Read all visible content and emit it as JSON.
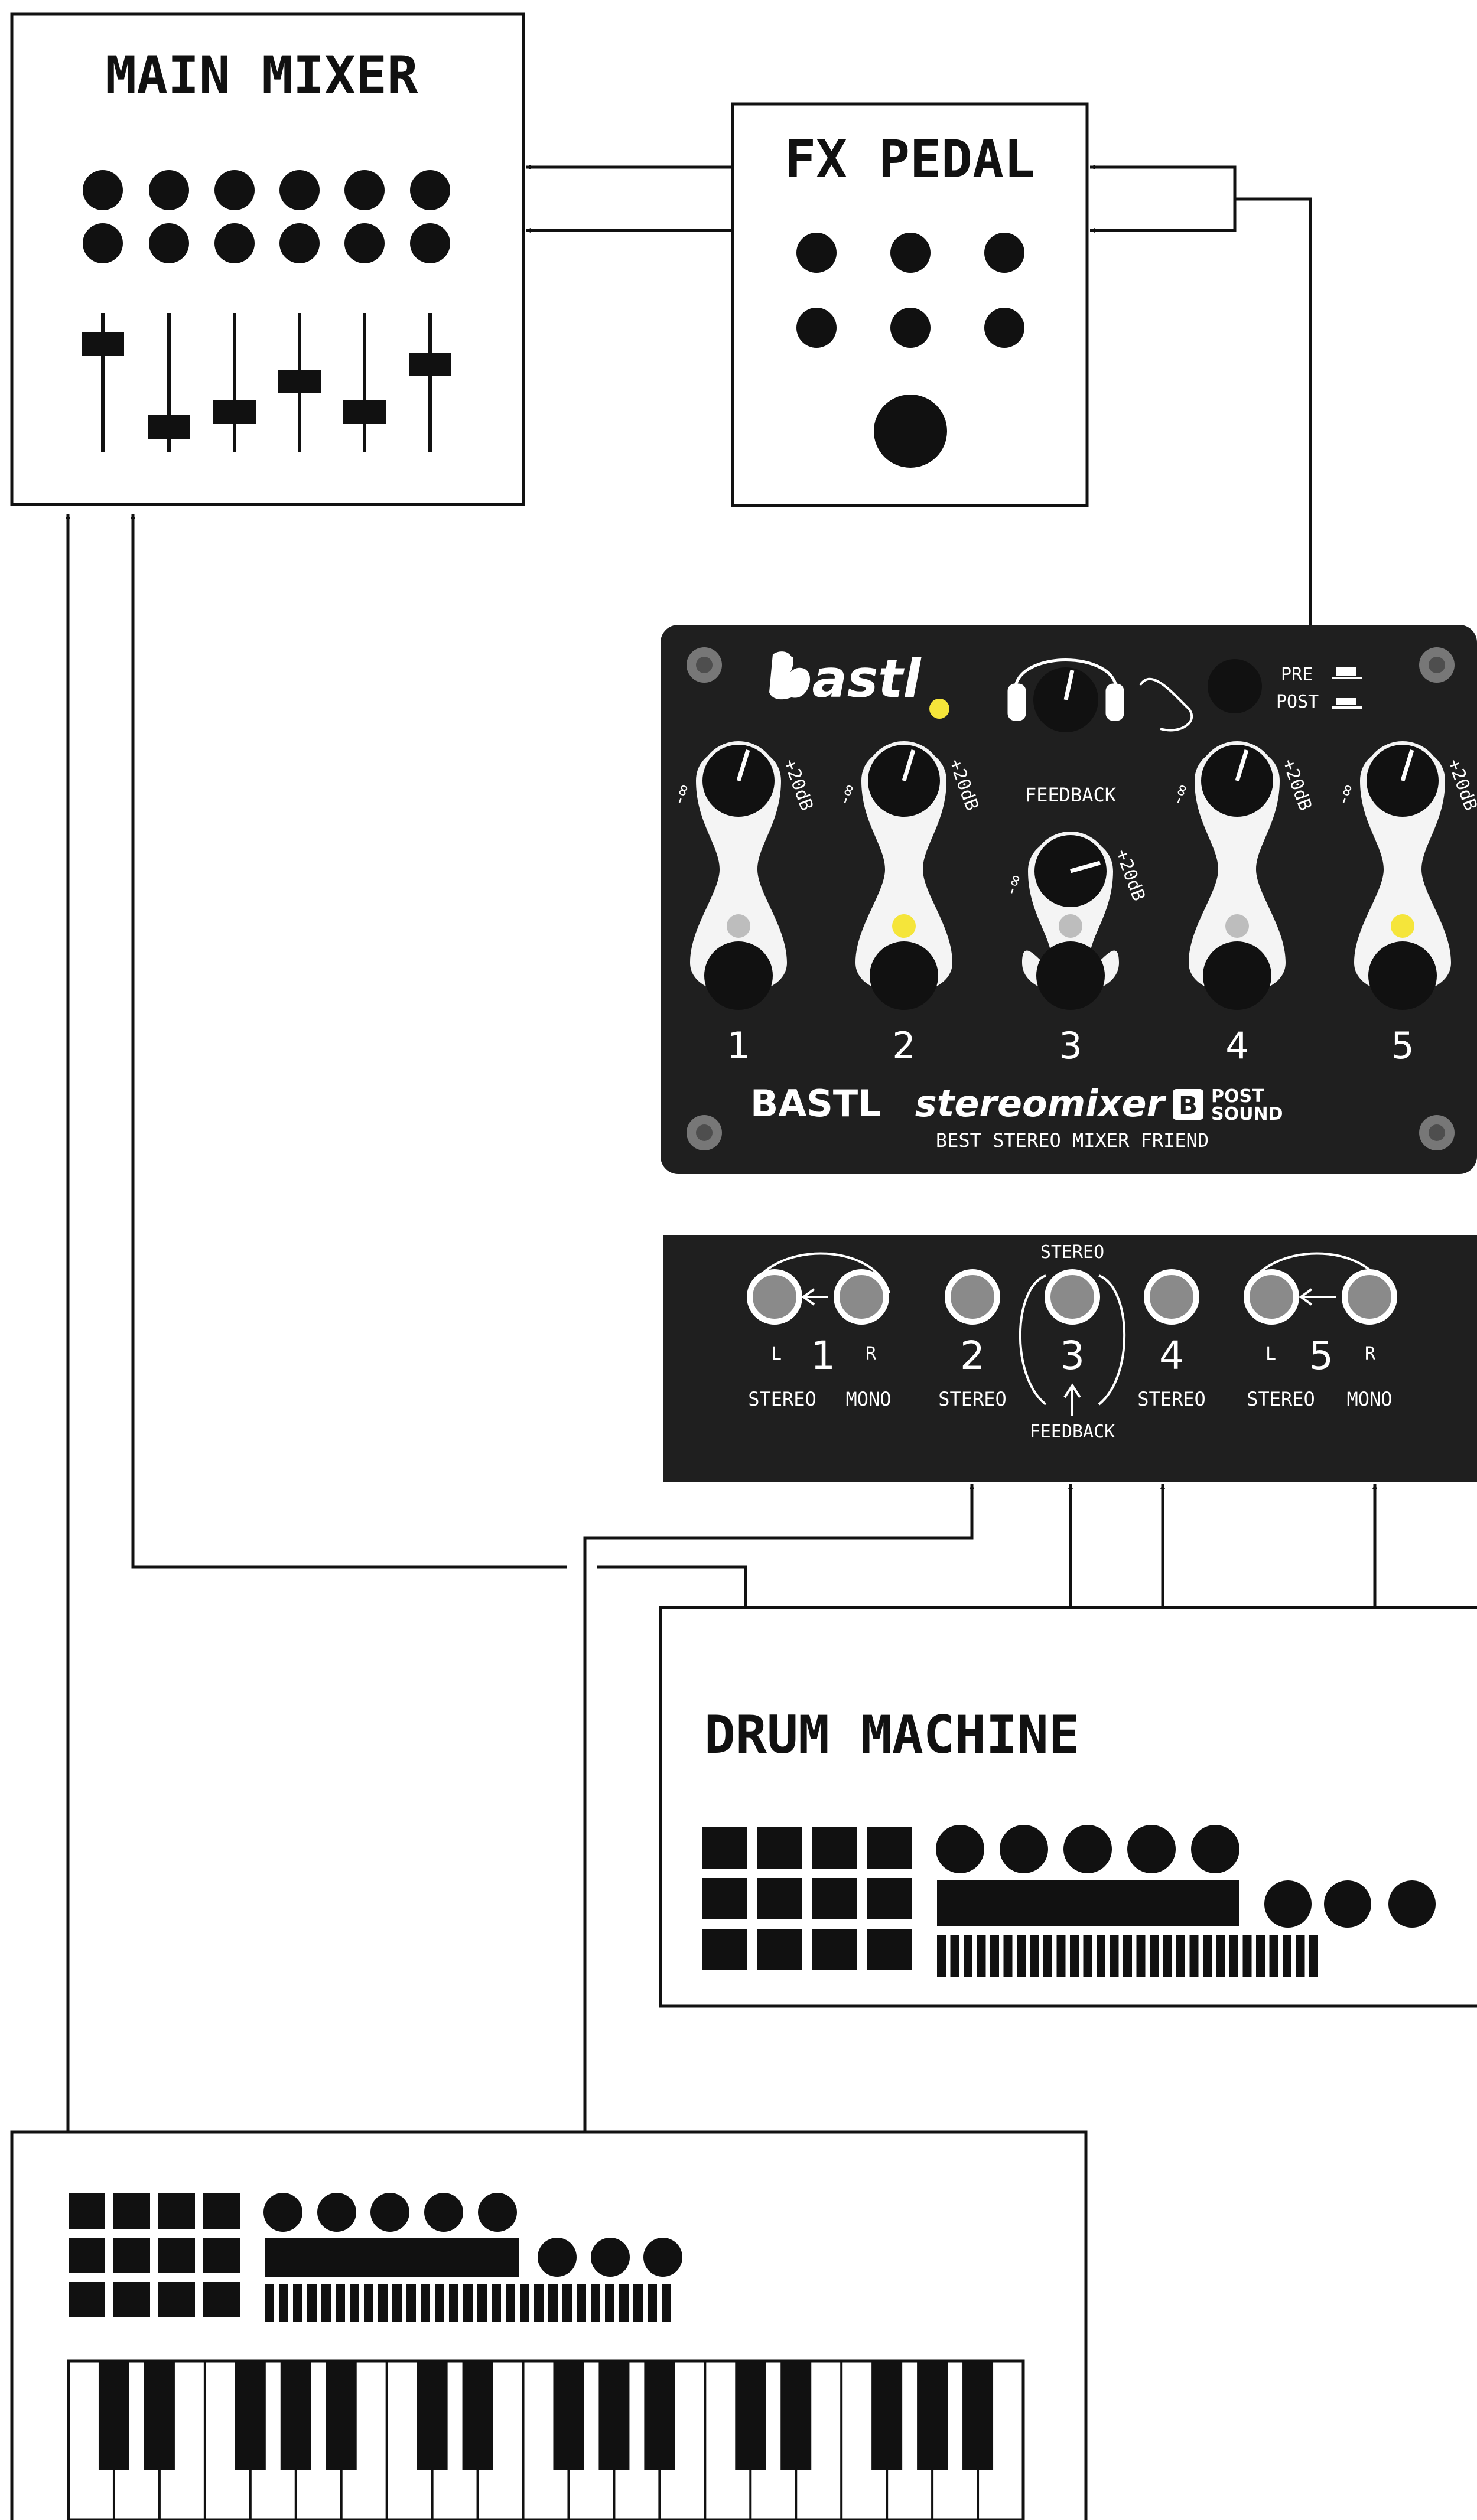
{
  "devices": {
    "main_mixer": {
      "title": "MAIN MIXER"
    },
    "fx_pedal": {
      "title": "FX PEDAL"
    },
    "drum_machine": {
      "title": "DRUM MACHINE"
    }
  },
  "stereomixer": {
    "brand": "BASTL",
    "product_script": "stereomixer",
    "partner_badge": "B",
    "partner": [
      "POST",
      "SOUND"
    ],
    "logo_script": "bastl",
    "tagline": "BEST STEREO MIXER FRIEND",
    "switch_labels": {
      "pre": "PRE",
      "post": "POST"
    },
    "feedback_label": "FEEDBACK",
    "knob_min": "-∞",
    "knob_max": "+20dB",
    "channels": [
      "1",
      "2",
      "3",
      "4",
      "5"
    ]
  },
  "io_panel": {
    "stereo_top": "STEREO",
    "feedback_bottom": "FEEDBACK",
    "groups": [
      {
        "number": "1",
        "left": "L",
        "right": "R",
        "labels": [
          "STEREO",
          "MONO"
        ]
      },
      {
        "number": "2",
        "labels": [
          "STEREO"
        ]
      },
      {
        "number": "3",
        "labels": []
      },
      {
        "number": "4",
        "labels": [
          "STEREO"
        ]
      },
      {
        "number": "5",
        "left": "L",
        "right": "R",
        "labels": [
          "STEREO",
          "MONO"
        ]
      }
    ]
  },
  "colors": {
    "panel": "#1f1f1f",
    "line": "#111111",
    "led_on": "#f5e53a",
    "led_off": "#bdbdbd",
    "jack_ring": "#8a8a8a"
  }
}
